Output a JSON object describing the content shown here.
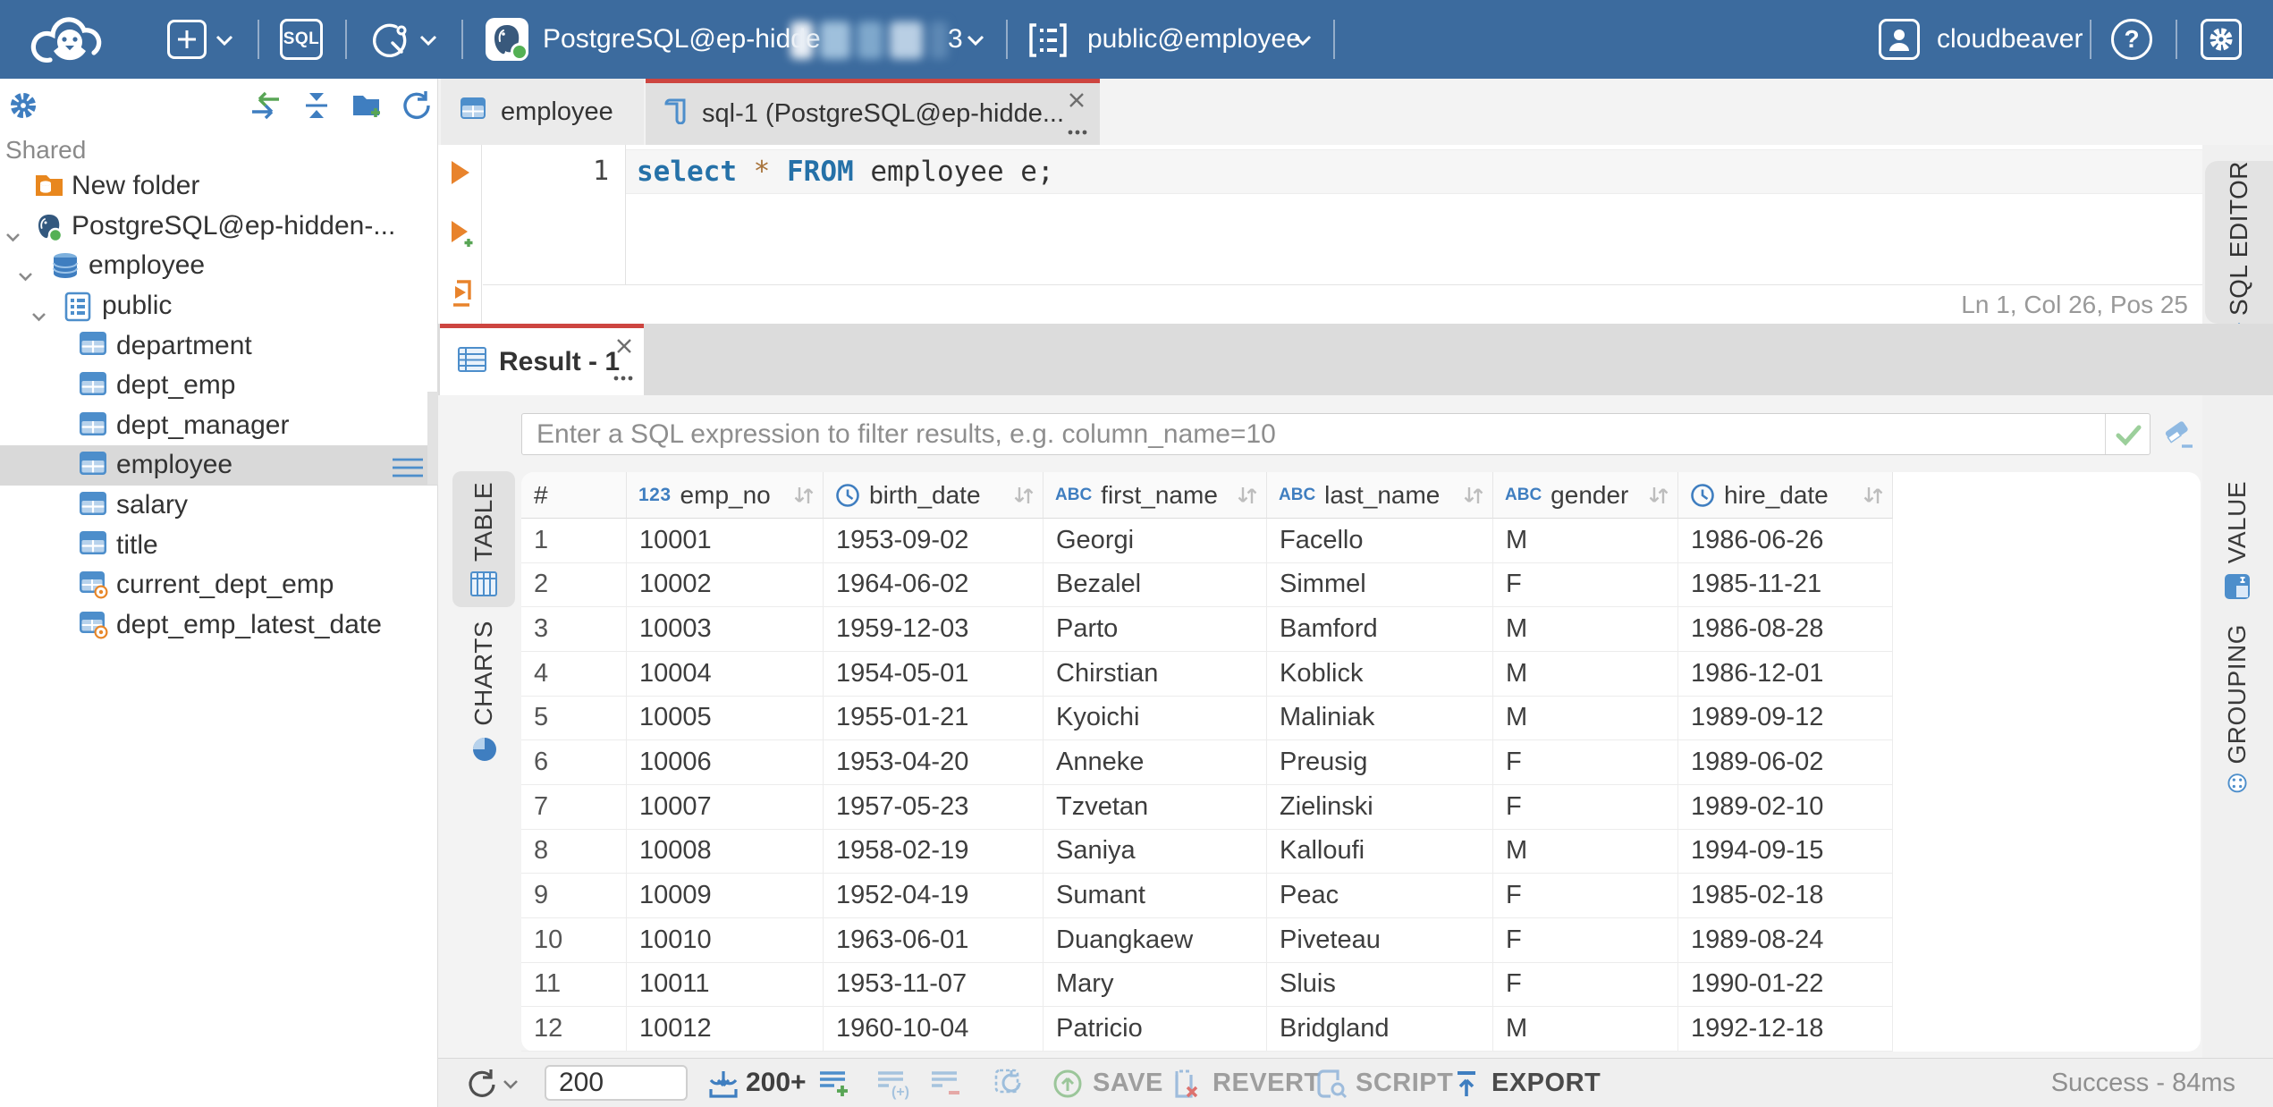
{
  "topbar": {
    "connection": "PostgreSQL@ep-hidde",
    "connection_suffix": "3",
    "schema": "public@employee",
    "user": "cloudbeaver"
  },
  "sidebar": {
    "section": "Shared",
    "tree": [
      {
        "label": "New folder",
        "icon": "folderdb",
        "level": 1,
        "chevron": false,
        "selected": false
      },
      {
        "label": "PostgreSQL@ep-hidden-...",
        "icon": "postgres",
        "level": 1,
        "chevron": true,
        "selected": false
      },
      {
        "label": "employee",
        "icon": "database",
        "level": 2,
        "chevron": true,
        "selected": false
      },
      {
        "label": "public",
        "icon": "schema",
        "level": 3,
        "chevron": true,
        "selected": false
      },
      {
        "label": "department",
        "icon": "table",
        "level": 4,
        "chevron": false,
        "selected": false
      },
      {
        "label": "dept_emp",
        "icon": "table",
        "level": 4,
        "chevron": false,
        "selected": false
      },
      {
        "label": "dept_manager",
        "icon": "table",
        "level": 4,
        "chevron": false,
        "selected": false
      },
      {
        "label": "employee",
        "icon": "table",
        "level": 4,
        "chevron": false,
        "selected": true
      },
      {
        "label": "salary",
        "icon": "table",
        "level": 4,
        "chevron": false,
        "selected": false
      },
      {
        "label": "title",
        "icon": "table",
        "level": 4,
        "chevron": false,
        "selected": false
      },
      {
        "label": "current_dept_emp",
        "icon": "view",
        "level": 4,
        "chevron": false,
        "selected": false
      },
      {
        "label": "dept_emp_latest_date",
        "icon": "view",
        "level": 4,
        "chevron": false,
        "selected": false
      }
    ]
  },
  "tabs": {
    "table_tab": "employee",
    "sql_tab": "sql-1 (PostgreSQL@ep-hidde..."
  },
  "editor": {
    "line_number": "1",
    "code": {
      "kw1": "select",
      "star": "*",
      "kw2": "FROM",
      "rest": " employee e;"
    },
    "status": "Ln 1, Col 26, Pos 25",
    "side_tab": "SQL EDITOR"
  },
  "result": {
    "tab": "Result - 1",
    "filter_placeholder": "Enter a SQL expression to filter results, e.g. column_name=10",
    "left_tabs": [
      "TABLE",
      "CHARTS"
    ],
    "right_tabs": [
      "VALUE",
      "GROUPING"
    ]
  },
  "grid": {
    "columns": [
      {
        "label": "#",
        "type": "rownum"
      },
      {
        "label": "emp_no",
        "type": "number"
      },
      {
        "label": "birth_date",
        "type": "date"
      },
      {
        "label": "first_name",
        "type": "text"
      },
      {
        "label": "last_name",
        "type": "text"
      },
      {
        "label": "gender",
        "type": "text"
      },
      {
        "label": "hire_date",
        "type": "date"
      }
    ],
    "rows": [
      [
        "1",
        "10001",
        "1953-09-02",
        "Georgi",
        "Facello",
        "M",
        "1986-06-26"
      ],
      [
        "2",
        "10002",
        "1964-06-02",
        "Bezalel",
        "Simmel",
        "F",
        "1985-11-21"
      ],
      [
        "3",
        "10003",
        "1959-12-03",
        "Parto",
        "Bamford",
        "M",
        "1986-08-28"
      ],
      [
        "4",
        "10004",
        "1954-05-01",
        "Chirstian",
        "Koblick",
        "M",
        "1986-12-01"
      ],
      [
        "5",
        "10005",
        "1955-01-21",
        "Kyoichi",
        "Maliniak",
        "M",
        "1989-09-12"
      ],
      [
        "6",
        "10006",
        "1953-04-20",
        "Anneke",
        "Preusig",
        "F",
        "1989-06-02"
      ],
      [
        "7",
        "10007",
        "1957-05-23",
        "Tzvetan",
        "Zielinski",
        "F",
        "1989-02-10"
      ],
      [
        "8",
        "10008",
        "1958-02-19",
        "Saniya",
        "Kalloufi",
        "M",
        "1994-09-15"
      ],
      [
        "9",
        "10009",
        "1952-04-19",
        "Sumant",
        "Peac",
        "F",
        "1985-02-18"
      ],
      [
        "10",
        "10010",
        "1963-06-01",
        "Duangkaew",
        "Piveteau",
        "F",
        "1989-08-24"
      ],
      [
        "11",
        "10011",
        "1953-11-07",
        "Mary",
        "Sluis",
        "F",
        "1990-01-22"
      ],
      [
        "12",
        "10012",
        "1960-10-04",
        "Patricio",
        "Bridgland",
        "M",
        "1992-12-18"
      ]
    ]
  },
  "toolbar": {
    "rows_value": "200",
    "fetch_label": "200+",
    "save": "SAVE",
    "revert": "REVERT",
    "script": "SCRIPT",
    "export": "EXPORT",
    "status": "Success - 84ms"
  }
}
